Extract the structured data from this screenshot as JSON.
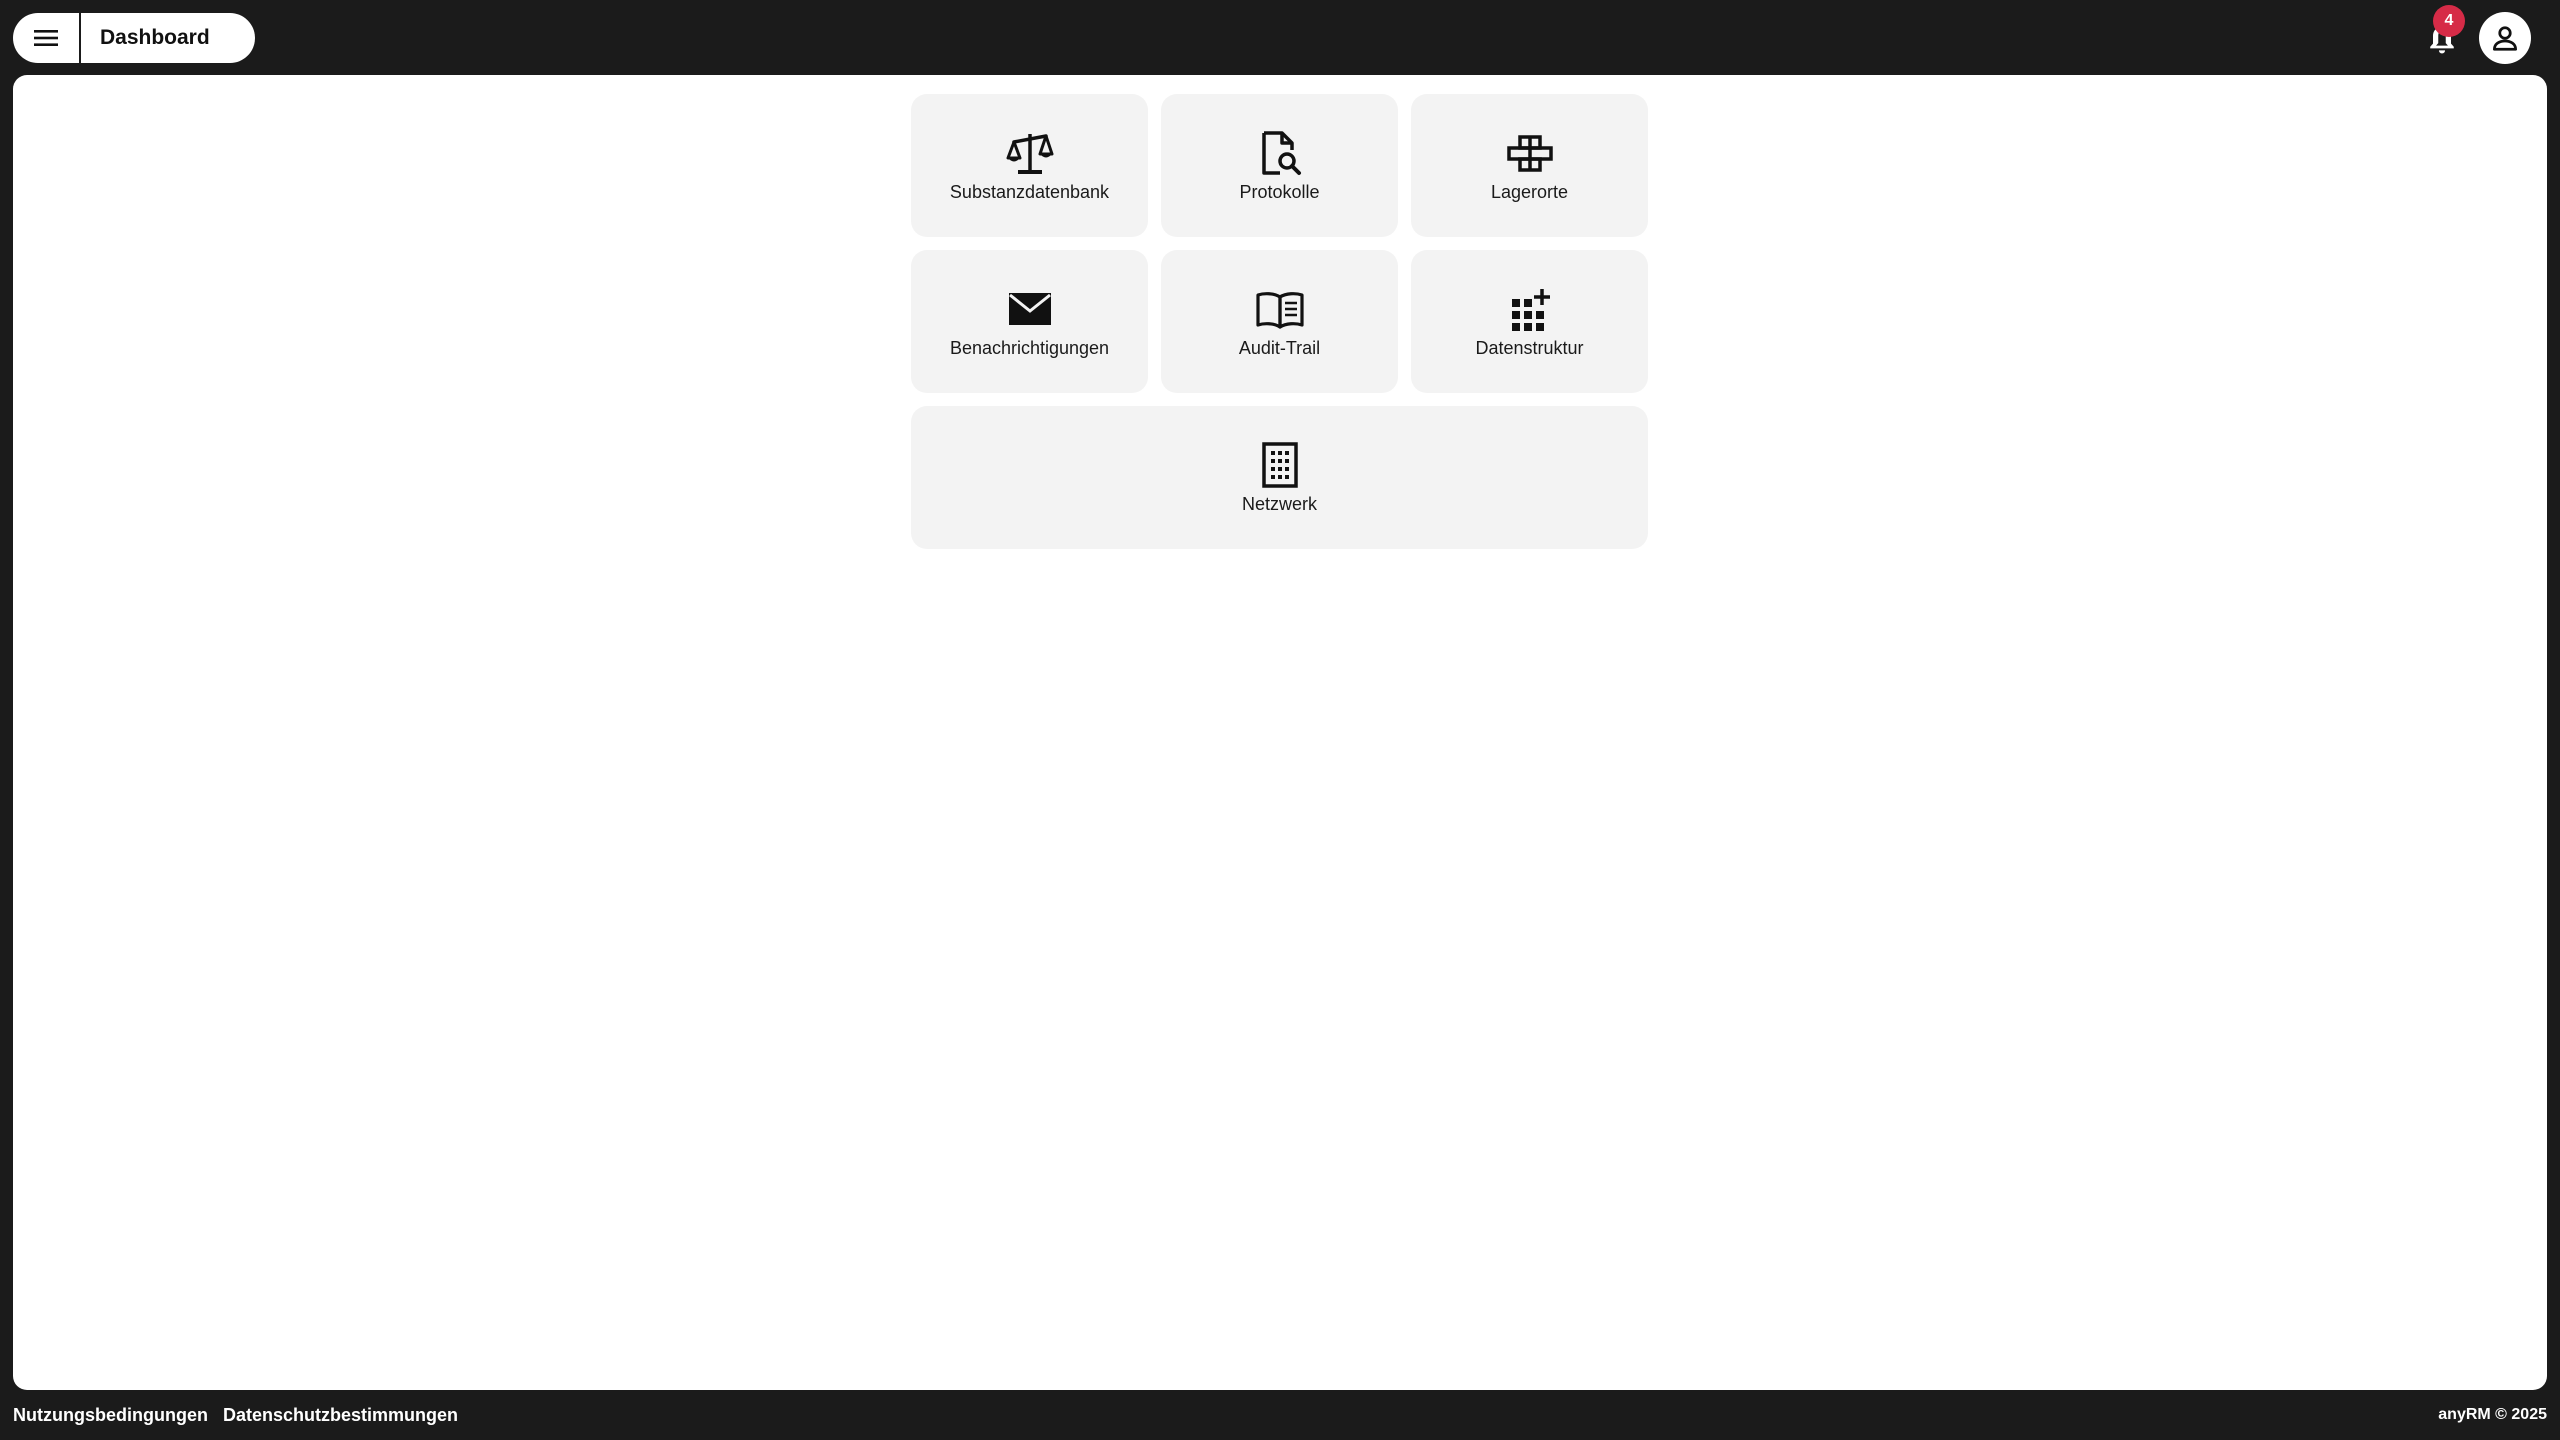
{
  "header": {
    "page_title": "Dashboard",
    "notification_count": "4",
    "badge_color": "#d62b47"
  },
  "tiles": [
    {
      "label": "Substanzdatenbank",
      "icon": "balance-scale-icon"
    },
    {
      "label": "Protokolle",
      "icon": "document-search-icon"
    },
    {
      "label": "Lagerorte",
      "icon": "storage-blocks-icon"
    },
    {
      "label": "Benachrichtigungen",
      "icon": "envelope-icon"
    },
    {
      "label": "Audit-Trail",
      "icon": "open-book-icon"
    },
    {
      "label": "Datenstruktur",
      "icon": "grid-add-icon"
    },
    {
      "label": "Netzwerk",
      "icon": "building-icon"
    }
  ],
  "footer": {
    "terms": "Nutzungsbedingungen",
    "privacy": "Datenschutzbestimmungen",
    "copyright": "anyRM © 2025"
  }
}
